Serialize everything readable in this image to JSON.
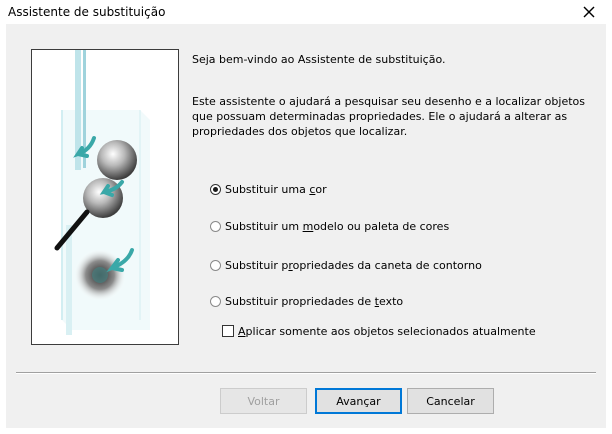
{
  "window": {
    "title": "Assistente de substituição",
    "close_icon": "close-icon"
  },
  "content": {
    "intro": "Seja bem-vindo ao Assistente de substituição.",
    "description": "Este assistente o ajudará a pesquisar seu desenho e a localizar objetos que possuam determinadas propriedades. Ele o ajudará a alterar as propriedades dos objetos que localizar."
  },
  "options": [
    {
      "label_before": "Substituir uma ",
      "mnemonic": "c",
      "label_after": "or",
      "checked": true
    },
    {
      "label_before": "Substituir um ",
      "mnemonic": "m",
      "label_after": "odelo ou paleta de cores",
      "checked": false
    },
    {
      "label_before": "Substituir p",
      "mnemonic": "r",
      "label_after": "opriedades da caneta de contorno",
      "checked": false
    },
    {
      "label_before": "Substituir propriedades de ",
      "mnemonic": "t",
      "label_after": "exto",
      "checked": false
    }
  ],
  "selected_only": {
    "label_before": "",
    "mnemonic": "A",
    "label_after": "plicar somente aos objetos selecionados atualmente",
    "checked": false
  },
  "buttons": {
    "back": "Voltar",
    "next": "Avançar",
    "cancel": "Cancelar"
  },
  "colors": {
    "accent": "#0078d7",
    "arrow": "#3aa8a8",
    "dialog_bg": "#f0f0f0"
  }
}
